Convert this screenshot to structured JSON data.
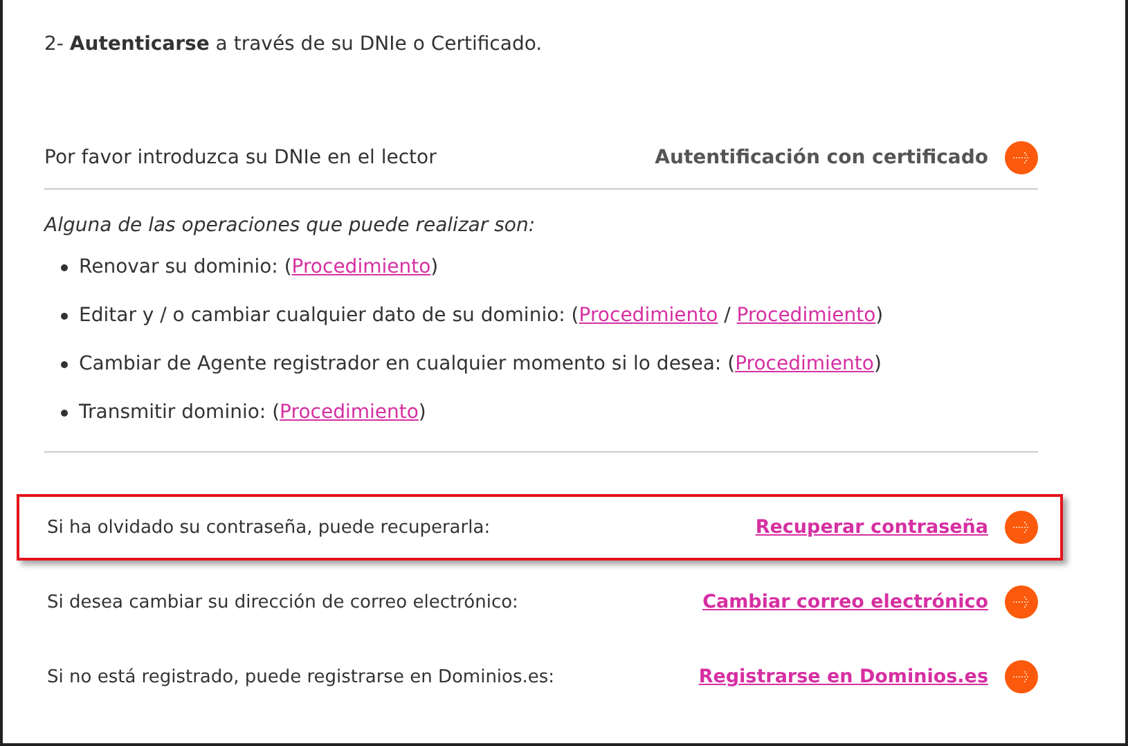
{
  "heading": "2- **Autenticarse** a través de su DNIe o Certificado.",
  "dnie_row": {
    "text": "Por favor introduzca su DNIe en el lector",
    "link": "Autentificación con certificado"
  },
  "operations_title": "Alguna de las operaciones que puede realizar son:",
  "operations": [
    {
      "parts": [
        {
          "kind": "text",
          "text": "Renovar su dominio: ("
        },
        {
          "kind": "link",
          "text": "Procedimiento"
        },
        {
          "kind": "text",
          "text": ")"
        }
      ]
    },
    {
      "parts": [
        {
          "kind": "text",
          "text": "Editar y / o cambiar cualquier dato de su dominio: ("
        },
        {
          "kind": "link",
          "text": "Procedimiento"
        },
        {
          "kind": "text",
          "text": " / "
        },
        {
          "kind": "link",
          "text": "Procedimiento"
        },
        {
          "kind": "text",
          "text": ")"
        }
      ]
    },
    {
      "parts": [
        {
          "kind": "text",
          "text": "Cambiar de Agente registrador en cualquier momento si lo desea: ("
        },
        {
          "kind": "link",
          "text": "Procedimiento"
        },
        {
          "kind": "text",
          "text": ")"
        }
      ]
    },
    {
      "parts": [
        {
          "kind": "text",
          "text": "Transmitir dominio: ("
        },
        {
          "kind": "link",
          "text": "Procedimiento"
        },
        {
          "kind": "text",
          "text": ")"
        }
      ]
    }
  ],
  "actions": [
    {
      "text": "Si ha olvidado su contraseña, puede recuperarla:",
      "link": "Recuperar contraseña",
      "highlighted": true
    },
    {
      "text": "Si desea cambiar su dirección de correo electrónico:",
      "link": "Cambiar correo electrónico",
      "highlighted": false
    },
    {
      "text": "Si no está registrado, puede registrarse en Dominios.es:",
      "link": "Registrarse en Dominios.es",
      "highlighted": false
    }
  ]
}
